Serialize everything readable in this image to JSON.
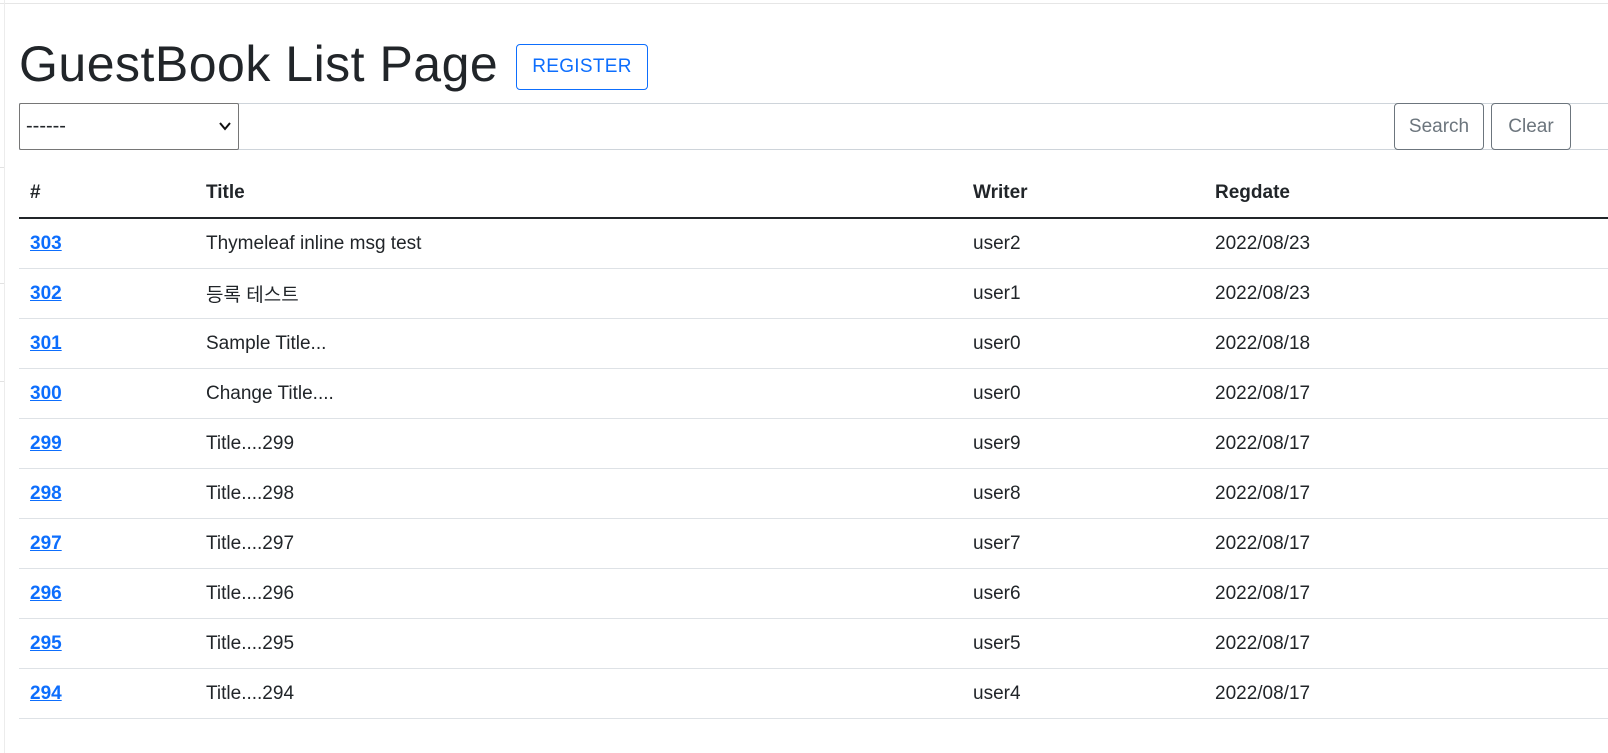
{
  "header": {
    "title": "GuestBook List Page",
    "register_label": "REGISTER"
  },
  "search": {
    "type_selected": "------",
    "keyword_value": "",
    "search_label": "Search",
    "clear_label": "Clear"
  },
  "table": {
    "columns": [
      "#",
      "Title",
      "Writer",
      "Regdate"
    ],
    "rows": [
      {
        "gno": "303",
        "title": "Thymeleaf inline msg test",
        "writer": "user2",
        "regdate": "2022/08/23"
      },
      {
        "gno": "302",
        "title": "등록 테스트",
        "writer": "user1",
        "regdate": "2022/08/23"
      },
      {
        "gno": "301",
        "title": "Sample Title...",
        "writer": "user0",
        "regdate": "2022/08/18"
      },
      {
        "gno": "300",
        "title": "Change Title....",
        "writer": "user0",
        "regdate": "2022/08/17"
      },
      {
        "gno": "299",
        "title": "Title....299",
        "writer": "user9",
        "regdate": "2022/08/17"
      },
      {
        "gno": "298",
        "title": "Title....298",
        "writer": "user8",
        "regdate": "2022/08/17"
      },
      {
        "gno": "297",
        "title": "Title....297",
        "writer": "user7",
        "regdate": "2022/08/17"
      },
      {
        "gno": "296",
        "title": "Title....296",
        "writer": "user6",
        "regdate": "2022/08/17"
      },
      {
        "gno": "295",
        "title": "Title....295",
        "writer": "user5",
        "regdate": "2022/08/17"
      },
      {
        "gno": "294",
        "title": "Title....294",
        "writer": "user4",
        "regdate": "2022/08/17"
      }
    ]
  },
  "colors": {
    "primary": "#0d6efd",
    "secondary": "#6c757d",
    "text": "#212529"
  }
}
